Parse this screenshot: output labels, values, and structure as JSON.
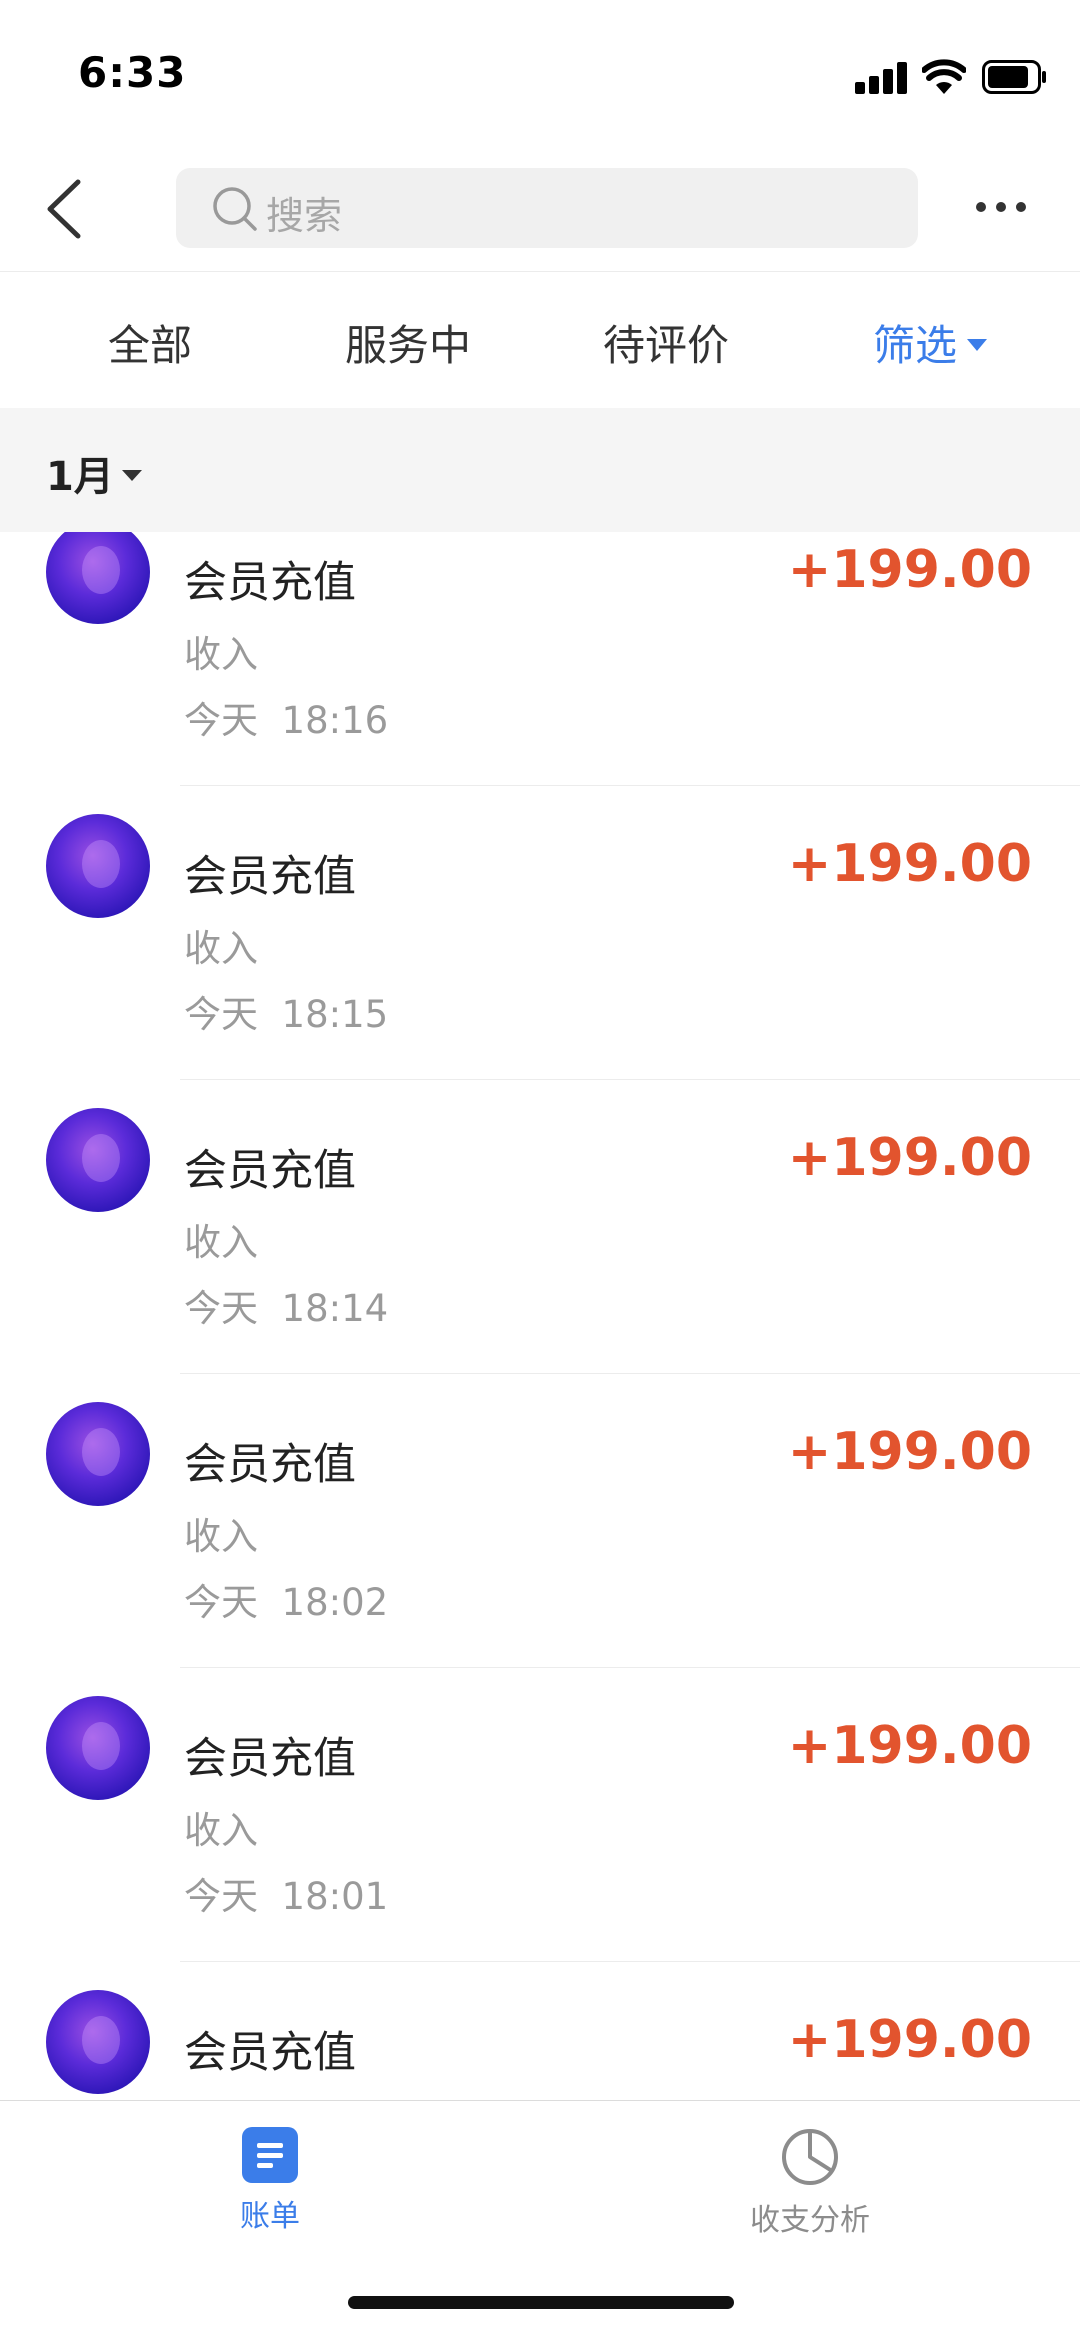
{
  "status_bar": {
    "time": "6:33"
  },
  "nav": {
    "search_placeholder": "搜索"
  },
  "tabs": [
    {
      "label": "全部"
    },
    {
      "label": "服务中"
    },
    {
      "label": "待评价"
    },
    {
      "label": "筛选"
    }
  ],
  "month": {
    "label": "1月"
  },
  "items": [
    {
      "title": "会员充值",
      "type": "收入",
      "day": "今天",
      "time": "18:16",
      "amount": "+199.00"
    },
    {
      "title": "会员充值",
      "type": "收入",
      "day": "今天",
      "time": "18:15",
      "amount": "+199.00"
    },
    {
      "title": "会员充值",
      "type": "收入",
      "day": "今天",
      "time": "18:14",
      "amount": "+199.00"
    },
    {
      "title": "会员充值",
      "type": "收入",
      "day": "今天",
      "time": "18:02",
      "amount": "+199.00"
    },
    {
      "title": "会员充值",
      "type": "收入",
      "day": "今天",
      "time": "18:01",
      "amount": "+199.00"
    },
    {
      "title": "会员充值",
      "amount": "+199.00"
    }
  ],
  "bottom_tabs": [
    {
      "label": "账单",
      "icon": "bill-icon",
      "active": true
    },
    {
      "label": "收支分析",
      "icon": "pie-chart-icon",
      "active": false
    }
  ],
  "colors": {
    "accent": "#3b7de9",
    "amount": "#e2542e",
    "muted": "#9a9a9a"
  }
}
